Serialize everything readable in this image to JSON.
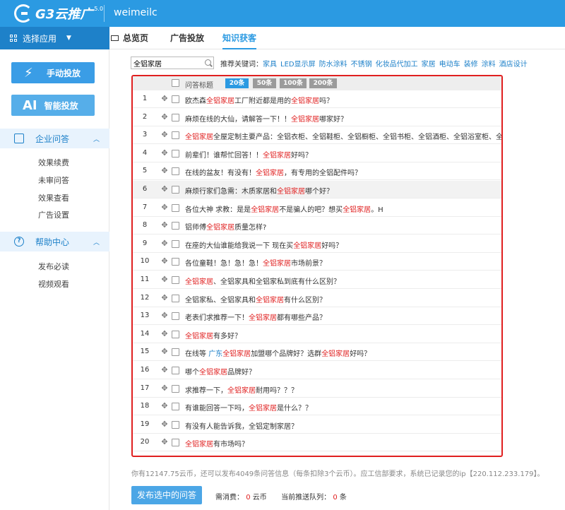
{
  "header": {
    "logo_text": "G3云推广",
    "logo_version": "5.0",
    "username": "weimeilc"
  },
  "sidebar": {
    "select_app": "选择应用",
    "manual_button": "手动投放",
    "ai_badge": "AI",
    "ai_button": "智能投放",
    "sections": [
      {
        "title": "企业问答",
        "icon": "qa-search-icon",
        "items": [
          "效果续费",
          "未审问答",
          "效果查看",
          "广告设置"
        ]
      },
      {
        "title": "帮助中心",
        "icon": "help-icon",
        "items": [
          "发布必读",
          "视频观看"
        ]
      }
    ]
  },
  "tabs": [
    {
      "label": "总览页",
      "active": false
    },
    {
      "label": "广告投放",
      "active": false
    },
    {
      "label": "知识获客",
      "active": true
    }
  ],
  "search": {
    "value": "全铝家居"
  },
  "keywords": {
    "label": "推荐关键词：",
    "items": [
      "家具",
      "LED显示屏",
      "防水涂料",
      "不锈钢",
      "化妆品代加工",
      "家居",
      "电动车",
      "装修",
      "涂料",
      "酒店设计"
    ]
  },
  "table": {
    "header_title": "问答标题",
    "page_sizes": [
      "20条",
      "50条",
      "100条",
      "200条"
    ],
    "active_page_size": "20条",
    "rows": [
      {
        "num": "1",
        "parts": [
          [
            "t",
            "欧杰森"
          ],
          [
            "h",
            "全铝家居"
          ],
          [
            "t",
            "工厂附近都是用的"
          ],
          [
            "h",
            "全铝家居"
          ],
          [
            "t",
            "吗？"
          ]
        ]
      },
      {
        "num": "2",
        "parts": [
          [
            "t",
            "麻烦在线的大仙，请解答一下！！"
          ],
          [
            "h",
            "全铝家居"
          ],
          [
            "t",
            "哪家好？"
          ]
        ]
      },
      {
        "num": "3",
        "parts": [
          [
            "h",
            "全铝家居"
          ],
          [
            "t",
            "全屋定制主要产品：全铝衣柜、全铝鞋柜、全铝橱柜、全铝书柜、全铝酒柜、全铝浴室柜、全？"
          ]
        ]
      },
      {
        "num": "4",
        "parts": [
          [
            "t",
            "前辈们！谁帮忙回答！！"
          ],
          [
            "h",
            "全铝家居"
          ],
          [
            "t",
            "好吗？"
          ]
        ]
      },
      {
        "num": "5",
        "parts": [
          [
            "t",
            "在线的盆友！有没有！"
          ],
          [
            "h",
            "全铝家居"
          ],
          [
            "t",
            "，有专用的全铝配件吗？"
          ]
        ]
      },
      {
        "num": "6",
        "parts": [
          [
            "t",
            "麻烦行家们急需：木质家居和"
          ],
          [
            "h",
            "全铝家居"
          ],
          [
            "t",
            "哪个好？"
          ]
        ]
      },
      {
        "num": "7",
        "parts": [
          [
            "t",
            "各位大神 求教：是是"
          ],
          [
            "h",
            "全铝家居"
          ],
          [
            "t",
            "不是骗人的吧？想买"
          ],
          [
            "h",
            "全铝家居"
          ],
          [
            "t",
            "。H"
          ]
        ]
      },
      {
        "num": "8",
        "parts": [
          [
            "t",
            "铝师傅"
          ],
          [
            "h",
            "全铝家居"
          ],
          [
            "t",
            "质量怎样?"
          ]
        ]
      },
      {
        "num": "9",
        "parts": [
          [
            "t",
            "在座的大仙谁能给我说一下 现在买"
          ],
          [
            "h",
            "全铝家居"
          ],
          [
            "t",
            "好吗？"
          ]
        ]
      },
      {
        "num": "10",
        "parts": [
          [
            "t",
            "各位童鞋！急！急！急！"
          ],
          [
            "h",
            "全铝家居"
          ],
          [
            "t",
            "市场前景？"
          ]
        ]
      },
      {
        "num": "11",
        "parts": [
          [
            "h",
            "全铝家居"
          ],
          [
            "t",
            "、全铝家具和全铝家私到底有什么区别？"
          ]
        ]
      },
      {
        "num": "12",
        "parts": [
          [
            "t",
            "全铝家私、全铝家具和"
          ],
          [
            "h",
            "全铝家居"
          ],
          [
            "t",
            "有什么区别？"
          ]
        ]
      },
      {
        "num": "13",
        "parts": [
          [
            "t",
            "老表们求推荐一下！"
          ],
          [
            "h",
            "全铝家居"
          ],
          [
            "t",
            "都有哪些产品？"
          ]
        ]
      },
      {
        "num": "14",
        "parts": [
          [
            "h",
            "全铝家居"
          ],
          [
            "t",
            "有多好？"
          ]
        ]
      },
      {
        "num": "15",
        "parts": [
          [
            "t",
            "在线等 "
          ],
          [
            "l",
            "广东"
          ],
          [
            "h",
            "全铝家居"
          ],
          [
            "t",
            "加盟哪个品牌好？选群"
          ],
          [
            "h",
            "全铝家居"
          ],
          [
            "t",
            "好吗？"
          ]
        ]
      },
      {
        "num": "16",
        "parts": [
          [
            "t",
            "哪个"
          ],
          [
            "h",
            "全铝家居"
          ],
          [
            "t",
            "品牌好？"
          ]
        ]
      },
      {
        "num": "17",
        "parts": [
          [
            "t",
            "求推荐一下，"
          ],
          [
            "h",
            "全铝家居"
          ],
          [
            "t",
            "耐用吗？？？"
          ]
        ]
      },
      {
        "num": "18",
        "parts": [
          [
            "t",
            "有谁能回答一下吗，"
          ],
          [
            "h",
            "全铝家居"
          ],
          [
            "t",
            "是什么？？"
          ]
        ]
      },
      {
        "num": "19",
        "parts": [
          [
            "t",
            "有没有人能告诉我，全铝定制家居？"
          ]
        ]
      },
      {
        "num": "20",
        "parts": [
          [
            "h",
            "全铝家居"
          ],
          [
            "t",
            "有市场吗？"
          ]
        ]
      }
    ]
  },
  "footer": {
    "balance_text": "你有12147.75云币，还可以发布4049条问答信息（每条扣除3个云币）。应工信部要求，系统已记录您的ip【220.112.233.179】。",
    "publish_button": "发布选中的问答",
    "cost_label": "需消费：",
    "cost_value": "0",
    "cost_unit": "云币",
    "queue_label": "当前推送队列：",
    "queue_value": "0",
    "queue_unit": "条"
  },
  "colors": {
    "brand": "#2b9ae2",
    "highlight": "#e02020",
    "link": "#1e81c9"
  }
}
